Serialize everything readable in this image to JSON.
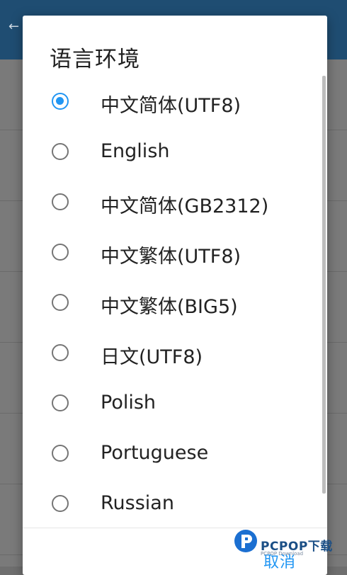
{
  "dialog": {
    "title": "语言环境",
    "options": [
      {
        "label": "中文简体(UTF8)",
        "selected": true
      },
      {
        "label": "English",
        "selected": false
      },
      {
        "label": "中文简体(GB2312)",
        "selected": false
      },
      {
        "label": "中文繁体(UTF8)",
        "selected": false
      },
      {
        "label": "中文繁体(BIG5)",
        "selected": false
      },
      {
        "label": "日文(UTF8)",
        "selected": false
      },
      {
        "label": "Polish",
        "selected": false
      },
      {
        "label": "Portuguese",
        "selected": false
      },
      {
        "label": "Russian",
        "selected": false
      }
    ],
    "cancel_label": "取消"
  },
  "watermark": {
    "brand": "PCPOP下载",
    "subtitle": "PCPOP Download"
  },
  "colors": {
    "accent": "#2196f3",
    "app_bar": "#1f4d72",
    "scrim": "#7a7a7a"
  }
}
